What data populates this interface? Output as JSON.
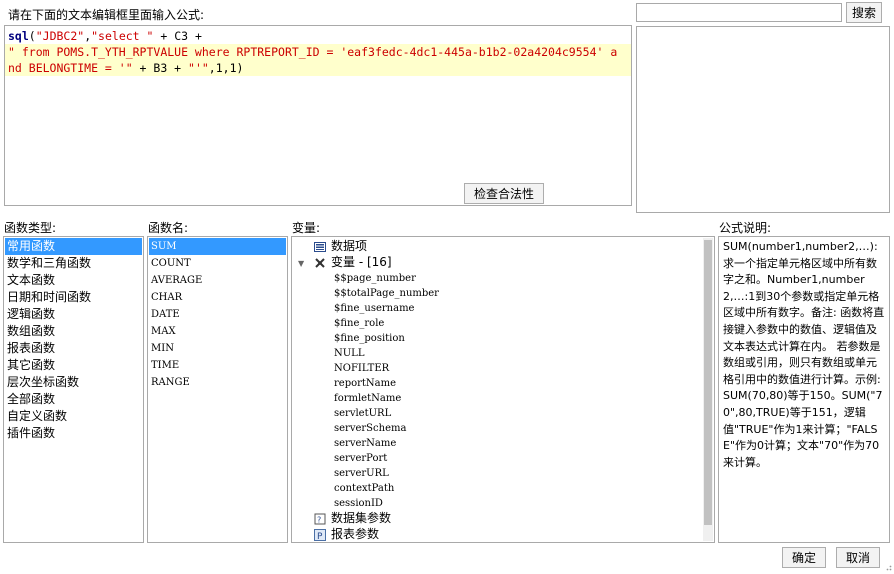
{
  "editor": {
    "prompt": "请在下面的文本编辑框里面输入公式:",
    "line1": [
      {
        "t": "kw",
        "v": "sql"
      },
      {
        "t": "pl",
        "v": "("
      },
      {
        "t": "str",
        "v": "\"JDBC2\""
      },
      {
        "t": "pl",
        "v": ","
      },
      {
        "t": "str",
        "v": "\"select \""
      },
      {
        "t": "pl",
        "v": " + C3 +"
      }
    ],
    "line2": [
      {
        "t": "str",
        "v": "\" from POMS.T_YTH_RPTVALUE where RPTREPORT_ID = 'eaf3fedc-4dc1-445a-b1b2-02a4204c9554' a"
      }
    ],
    "line3": [
      {
        "t": "str",
        "v": "nd BELONGTIME = '\""
      },
      {
        "t": "pl",
        "v": " + B3 + "
      },
      {
        "t": "str",
        "v": "\"'\""
      },
      {
        "t": "pl",
        "v": ",1,1)"
      }
    ]
  },
  "search": {
    "value": "",
    "button": "搜索"
  },
  "check_button": "检查合法性",
  "categories": {
    "title": "函数类型:",
    "items": [
      "常用函数",
      "数学和三角函数",
      "文本函数",
      "日期和时间函数",
      "逻辑函数",
      "数组函数",
      "报表函数",
      "其它函数",
      "层次坐标函数",
      "全部函数",
      "自定义函数",
      "插件函数"
    ],
    "selected": 0
  },
  "functions": {
    "title": "函数名:",
    "items": [
      "SUM",
      "COUNT",
      "AVERAGE",
      "CHAR",
      "DATE",
      "MAX",
      "MIN",
      "TIME",
      "RANGE"
    ],
    "selected": 0
  },
  "variables": {
    "title": "变量:",
    "dataset_label": "数据项",
    "var_group_label": "变量 - [16]",
    "items": [
      "$$page_number",
      "$$totalPage_number",
      "$fine_username",
      "$fine_role",
      "$fine_position",
      "NULL",
      "NOFILTER",
      "reportName",
      "formletName",
      "servletURL",
      "serverSchema",
      "serverName",
      "serverPort",
      "serverURL",
      "contextPath",
      "sessionID"
    ],
    "dataset_params": "数据集参数",
    "report_params": "报表参数"
  },
  "description": {
    "title": "公式说明:",
    "text": "SUM(number1,number2,…): 求一个指定单元格区域中所有数字之和。Number1,number2,…:1到30个参数或指定单元格区域中所有数字。备注: 函数将直接键入参数中的数值、逻辑值及文本表达式计算在内。 若参数是数组或引用，则只有数组或单元格引用中的数值进行计算。示例:SUM(70,80)等于150。SUM(\"70\",80,TRUE)等于151，逻辑值\"TRUE\"作为1来计算；\"FALSE\"作为0计算；文本\"70\"作为70来计算。"
  },
  "footer": {
    "ok": "确定",
    "cancel": "取消"
  }
}
